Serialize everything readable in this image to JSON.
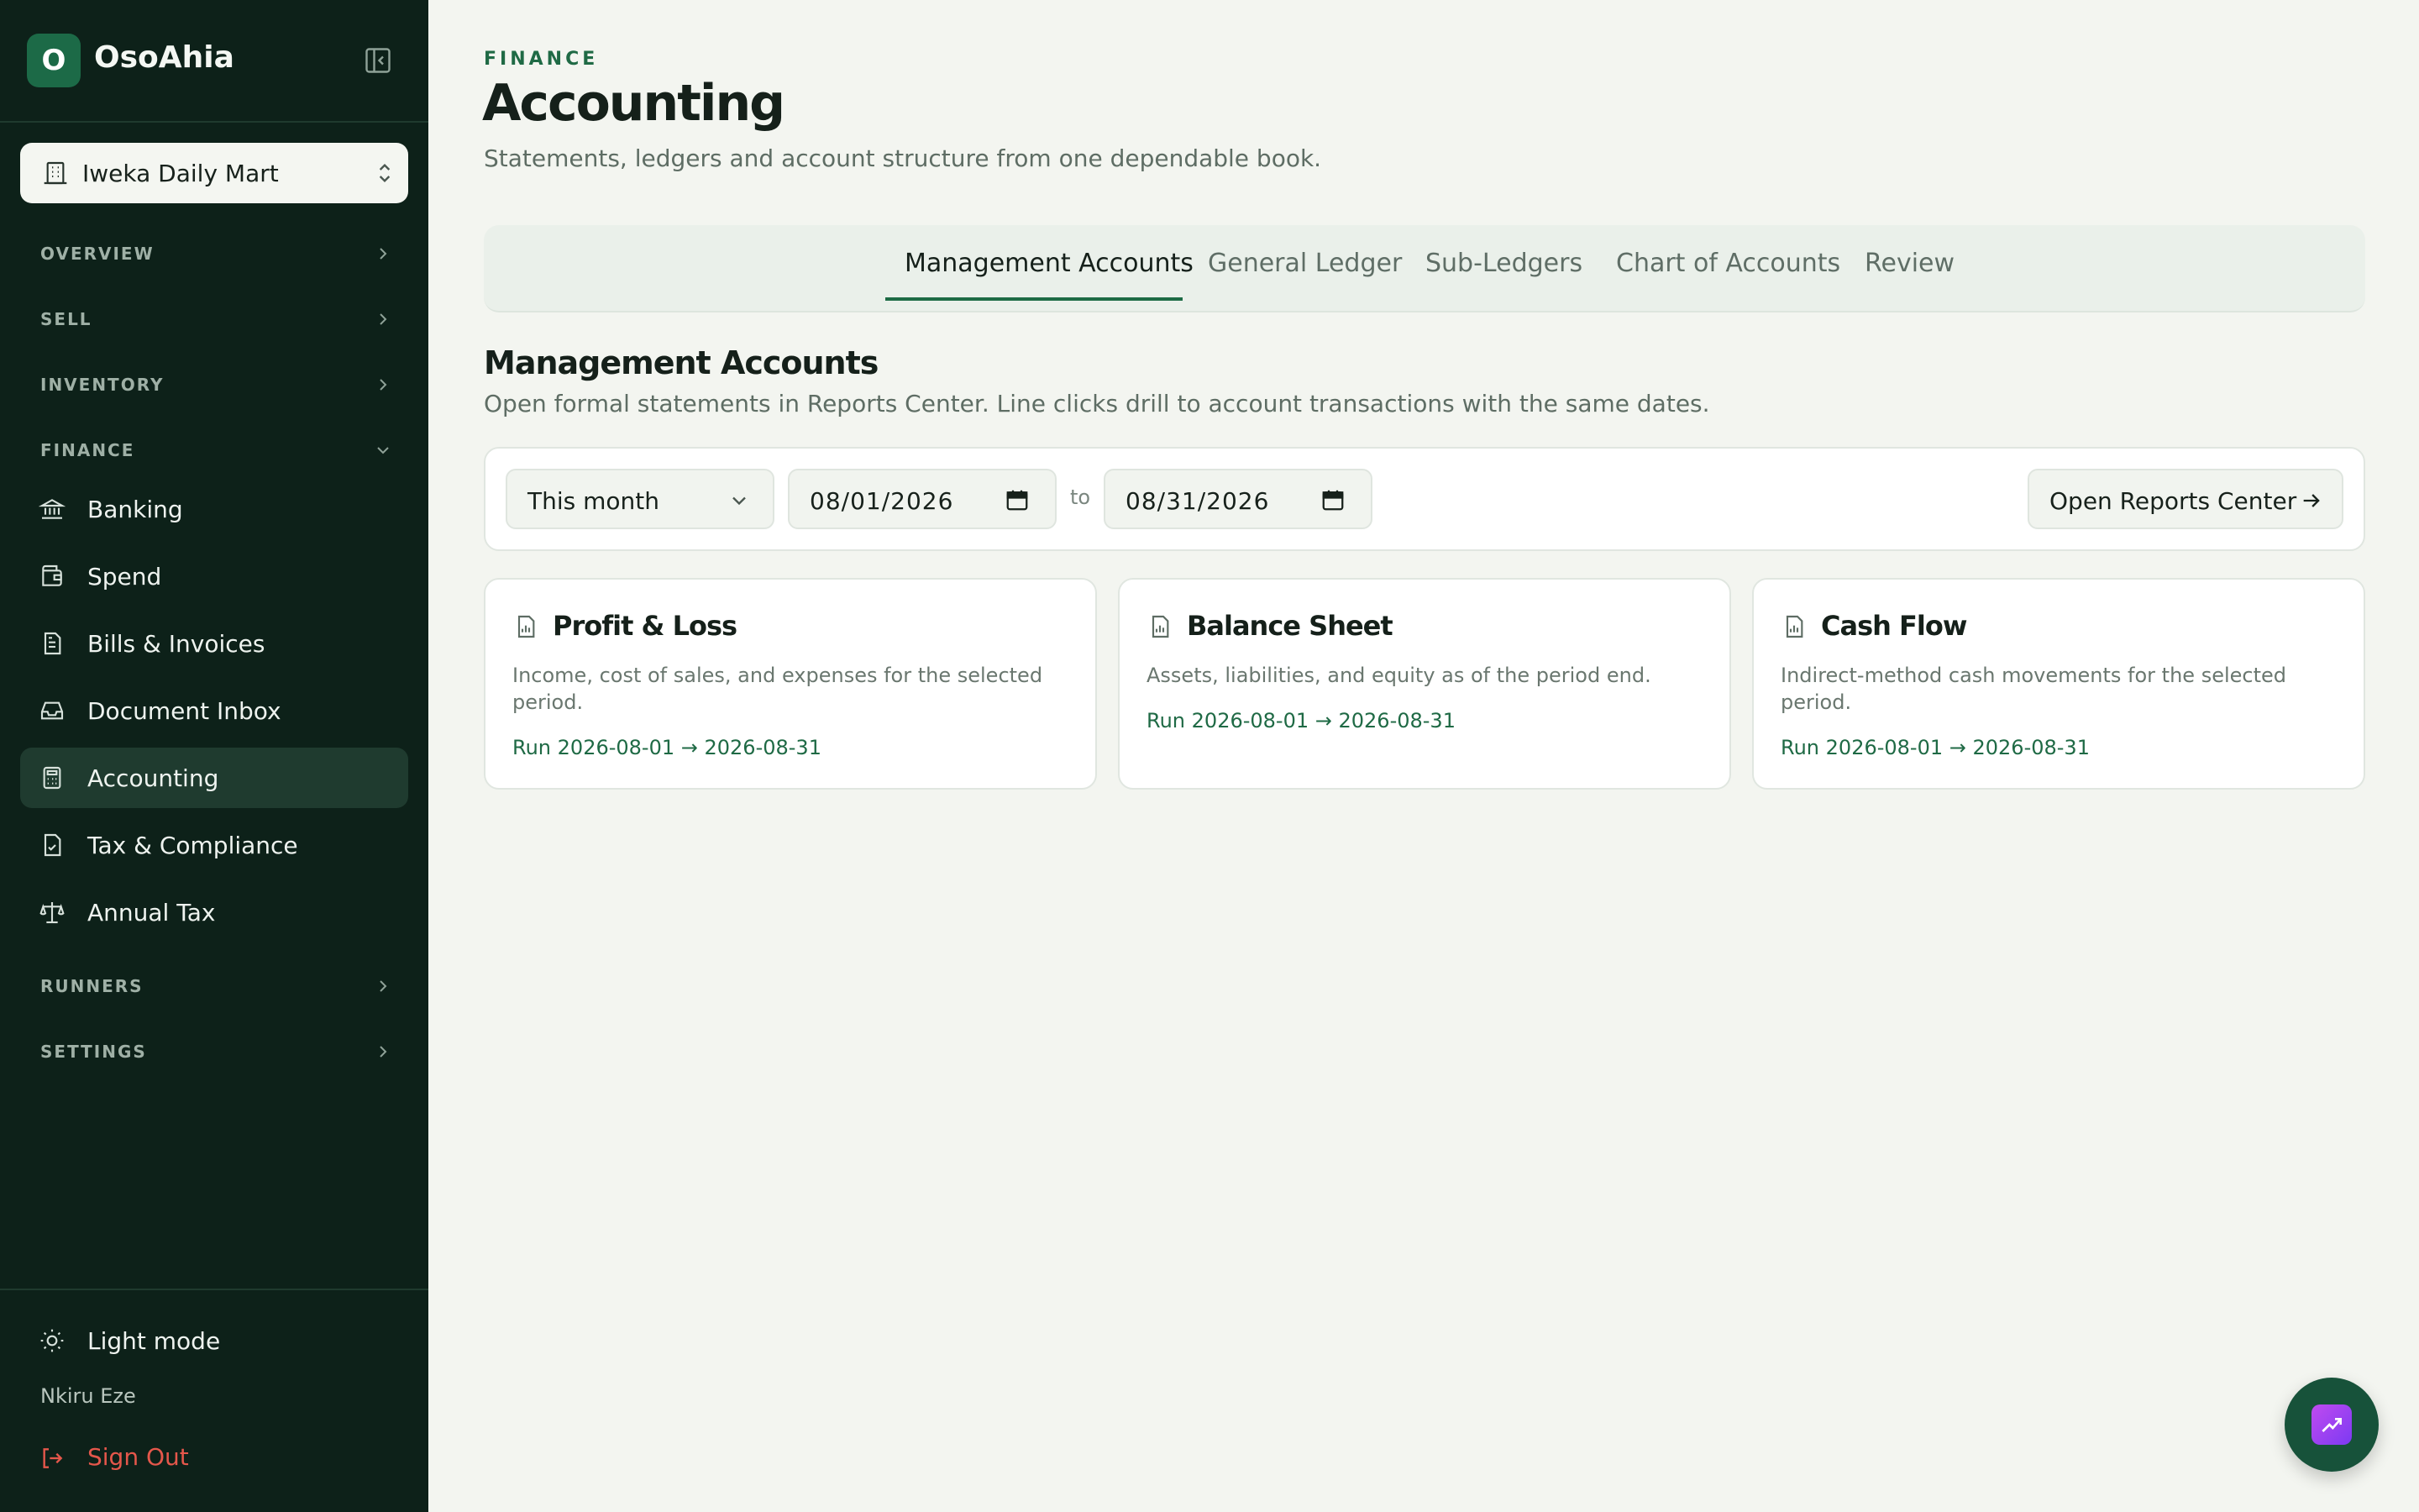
{
  "app": {
    "logo_letter": "O",
    "name": "OsoAhia"
  },
  "org": {
    "name": "Iweka Daily Mart"
  },
  "sidebar": {
    "sections": {
      "overview": "OVERVIEW",
      "sell": "SELL",
      "inventory": "INVENTORY",
      "finance": "FINANCE",
      "runners": "RUNNERS",
      "settings": "SETTINGS"
    },
    "finance_items": [
      {
        "label": "Banking",
        "icon": "bank-icon"
      },
      {
        "label": "Spend",
        "icon": "wallet-icon"
      },
      {
        "label": "Bills & Invoices",
        "icon": "receipt-icon"
      },
      {
        "label": "Document Inbox",
        "icon": "inbox-icon"
      },
      {
        "label": "Accounting",
        "icon": "calculator-icon",
        "active": true
      },
      {
        "label": "Tax & Compliance",
        "icon": "file-check-icon"
      },
      {
        "label": "Annual Tax",
        "icon": "scale-icon"
      }
    ],
    "theme_label": "Light mode",
    "user_name": "Nkiru Eze",
    "signout_label": "Sign Out"
  },
  "header": {
    "eyebrow": "FINANCE",
    "title": "Accounting",
    "subtitle": "Statements, ledgers and account structure from one dependable book."
  },
  "tabs": [
    {
      "label": "Management Accounts",
      "active": true
    },
    {
      "label": "General Ledger"
    },
    {
      "label": "Sub-Ledgers"
    },
    {
      "label": "Chart of Accounts"
    },
    {
      "label": "Review"
    }
  ],
  "section": {
    "title": "Management Accounts",
    "description": "Open formal statements in Reports Center. Line clicks drill to account transactions with the same dates."
  },
  "filters": {
    "period": "This month",
    "from_date": "08/01/2026",
    "to_label": "to",
    "to_date": "08/31/2026",
    "reports_button": "Open Reports Center"
  },
  "cards": [
    {
      "title": "Profit & Loss",
      "description": "Income, cost of sales, and expenses for the selected period.",
      "run": "Run 2026-08-01 → 2026-08-31"
    },
    {
      "title": "Balance Sheet",
      "description": "Assets, liabilities, and equity as of the period end.",
      "run": "Run 2026-08-01 → 2026-08-31"
    },
    {
      "title": "Cash Flow",
      "description": "Indirect-method cash movements for the selected period.",
      "run": "Run 2026-08-01 → 2026-08-31"
    }
  ],
  "colors": {
    "sidebar_bg": "#0d2119",
    "accent": "#1d6b45",
    "page_bg": "#f3f5f0",
    "danger": "#e5574b"
  }
}
